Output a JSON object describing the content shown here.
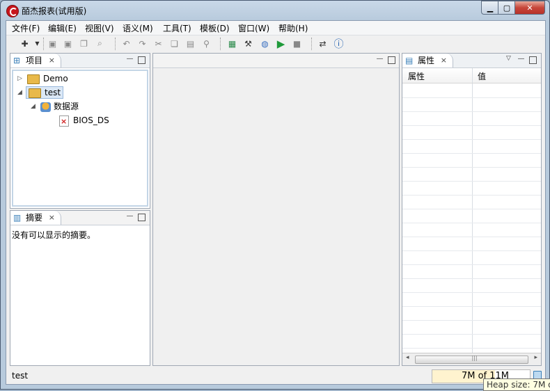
{
  "window": {
    "title": "皕杰报表(试用版)"
  },
  "menu": [
    "文件(F)",
    "编辑(E)",
    "视图(V)",
    "语义(M)",
    "工具(T)",
    "模板(D)",
    "窗口(W)",
    "帮助(H)"
  ],
  "project_panel": {
    "tab_label": "项目",
    "tree": [
      {
        "label": "Demo"
      },
      {
        "label": "test"
      },
      {
        "label": "数据源"
      },
      {
        "label": "BIOS_DS"
      }
    ]
  },
  "summary_panel": {
    "tab_label": "摘要",
    "empty_text": "没有可以显示的摘要。"
  },
  "properties_panel": {
    "tab_label": "属性",
    "columns": [
      "属性",
      "值"
    ]
  },
  "status": {
    "text": "test",
    "heap_label": "7M of 11M",
    "heap_used_fraction": 0.64,
    "tooltip": "Heap size: 7M of"
  }
}
